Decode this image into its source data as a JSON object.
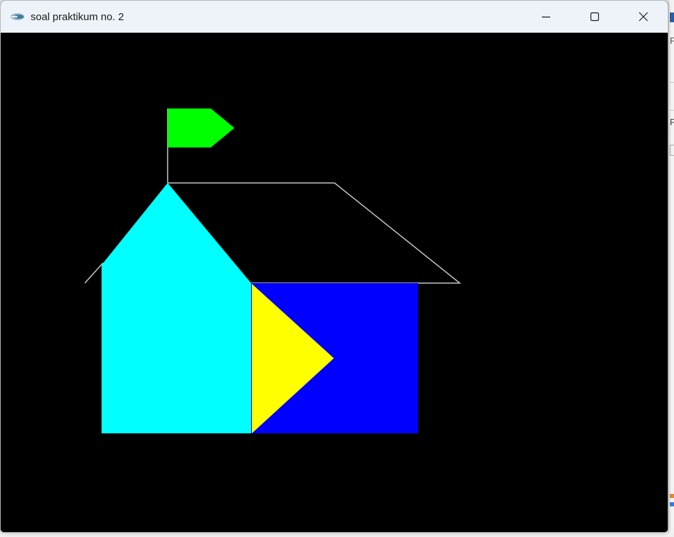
{
  "window": {
    "title": "soal praktikum no. 2",
    "buttons": {
      "minimize": "minimize",
      "maximize": "maximize",
      "close": "close"
    }
  },
  "icons": {
    "app": "app-icon",
    "minimize": "minimize-icon",
    "maximize": "maximize-icon",
    "close": "close-icon"
  },
  "colors": {
    "canvas_background": "#000000",
    "flag": "#00ff00",
    "front_gable": "#00ffff",
    "side_wall": "#0000ff",
    "triangle": "#ffff00",
    "outline": "#c8c8c8"
  },
  "drawing": {
    "shapes": [
      "flag-pole",
      "flag",
      "roof-outline",
      "front-gable",
      "side-wall",
      "triangle"
    ]
  }
}
